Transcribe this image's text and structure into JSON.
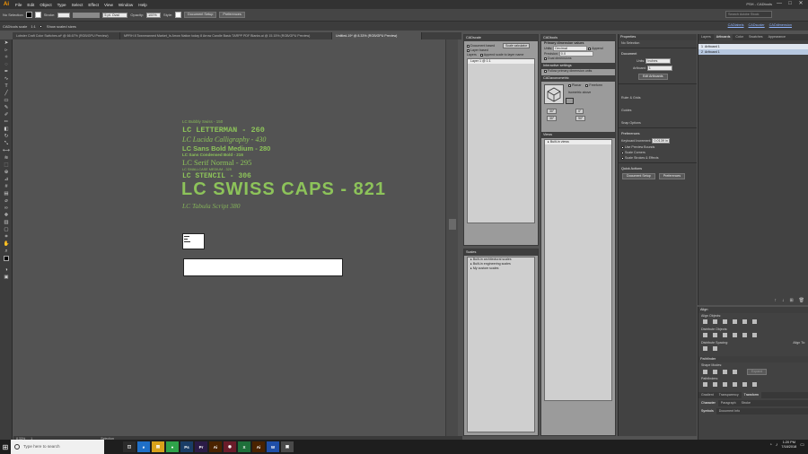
{
  "menubar": {
    "logo": "Ai",
    "items": [
      "File",
      "Edit",
      "Object",
      "Type",
      "Select",
      "Effect",
      "View",
      "Window",
      "Help"
    ],
    "workspace_label": "PSH - CADtools",
    "minimize": "—",
    "maximize": "□",
    "close": "✕"
  },
  "controlbar": {
    "selection": "No Selection",
    "stroke_label": "Stroke:",
    "stroke_value": "",
    "basic_label": "5 pt. Oval",
    "opacity_label": "Opacity:",
    "opacity_value": "100%",
    "style_label": "Style:",
    "doc_setup": "Document Setup",
    "preferences": "Preferences",
    "search_placeholder": "Search Adobe Stock"
  },
  "pluginrow": {
    "left_label": "CADtools scale",
    "scale_value": "1:1",
    "show_scaled": "Show scaled sizes",
    "links": [
      "CADlabels",
      "CADscaler",
      "CADdimension"
    ]
  },
  "tabs": [
    "Lobster Craft Color Switches.ai* @ 66.67% (RGB/GPU Preview)",
    "MPRH 8 Townmanned Market_Is Arrow Nation today 8 Arrow Candle Basic TARPP PDF Blanks.ai @ 15.15% (RGB/GPU Preview)",
    "Untitled-19* @ 8.33% (RGB/GPU Preview)"
  ],
  "canvas": {
    "font_samples": [
      "LC Bubbly Swiss - 150",
      "LC LETTERMAN - 260",
      "LC Lucida Calligraphy - 430",
      "LC Sans Bold Medium - 280",
      "LC Sans Condensed Bold - 216",
      "LC Serif Normal - 295",
      "LC SMALLCASE MEDIUM - 325",
      "LC STENCIL - 306",
      "LC SWISS CAPS - 821",
      "LC Tabula Script 380"
    ],
    "accent_color": "#8dc35a"
  },
  "statusbar": {
    "zoom": "8.33%",
    "artboard": "1",
    "tool": "Selection"
  },
  "cadscale": {
    "title": "CADscale",
    "doc_based": "Document based",
    "scale_btn": "Scale calculator",
    "layer_based": "Layer based",
    "layers_label": "Layers",
    "append": "Append scale to layer name",
    "layer_items": [
      "Layer 1 @ 1:1"
    ],
    "scales_title": "Scales",
    "scale_items": [
      "Built-in architectural scales",
      "Built-in engineering scales",
      "My custom scales"
    ]
  },
  "cadtools": {
    "title": "CADtools",
    "primary_label": "Primary dimension values",
    "units_label": "Units:",
    "units_value": "Decimal",
    "precision_label": "Precision:",
    "precision_value": "0.0",
    "append_units": "Append",
    "dual_dims": "Dual dimensions",
    "interactive_title": "Interactive settings",
    "follow_primary": "Follow primary dimension units",
    "axonometric_title": "CADaxonometric",
    "proj_options": [
      "Planar",
      "Freeform"
    ],
    "isometric_above": "Isometric above",
    "angle1": "30°",
    "angle2": "30°",
    "angle3": "0°",
    "angle4": "90°",
    "views_title": "Views",
    "views_items": [
      "Built-in views"
    ]
  },
  "properties": {
    "title": "Properties",
    "no_selection": "No Selection",
    "document_label": "Document",
    "units_label": "Units:",
    "units_value": "Inches",
    "artboard_label": "Artboard:",
    "artboard_value": "1",
    "edit_artboards": "Edit Artboards",
    "ruler_grids": "Ruler & Grids",
    "guides": "Guides",
    "snap_options": "Snap Options",
    "preferences_label": "Preferences",
    "keyboard_increment": "Keyboard Increment:",
    "keyboard_value": "0.0139 in",
    "use_preview_bounds": "Use Preview Bounds",
    "scale_corners": "Scale Corners",
    "scale_strokes": "Scale Strokes & Effects",
    "quick_actions": "Quick Actions",
    "doc_setup": "Document Setup",
    "preferences_btn": "Preferences"
  },
  "layers": {
    "tabs": [
      "Layers",
      "Artboards",
      "Color",
      "Swatches",
      "Appearance"
    ],
    "rows": [
      {
        "num": "1",
        "name": "Artboard 1"
      },
      {
        "num": "2",
        "name": "Artboard 1"
      }
    ]
  },
  "align": {
    "title": "Align",
    "align_objects": "Align Objects:",
    "distribute_objects": "Distribute Objects:",
    "distribute_spacing": "Distribute Spacing:",
    "align_to": "Align To:",
    "pathfinder_title": "Pathfinder",
    "shape_modes": "Shape Modes:",
    "expand": "Expand",
    "pathfinders": "Pathfinders:",
    "bottom_tabs": [
      "Gradient",
      "Transparency",
      "Transform"
    ],
    "char_tabs": [
      "Character",
      "Paragraph",
      "Stroke"
    ],
    "sym_tabs": [
      "Symbols",
      "Document Info"
    ]
  },
  "taskbar": {
    "search_placeholder": "Type here to search",
    "apps": [
      {
        "label": "◫",
        "color": "#2b2b2b"
      },
      {
        "label": "e",
        "color": "#1f6fc7"
      },
      {
        "label": "▤",
        "color": "#d9a21a"
      },
      {
        "label": "●",
        "color": "#2fa24a"
      },
      {
        "label": "Ps",
        "color": "#1a3d66"
      },
      {
        "label": "Pr",
        "color": "#2b1b47"
      },
      {
        "label": "Ai",
        "color": "#4a2300"
      },
      {
        "label": "◉",
        "color": "#6a1c2a"
      },
      {
        "label": "X",
        "color": "#1e6f3a"
      },
      {
        "label": "Ai",
        "color": "#4a2300"
      },
      {
        "label": "W",
        "color": "#1f4fa8"
      },
      {
        "label": "▣",
        "color": "#4a4a4a"
      }
    ],
    "time": "1:20 PM",
    "date": "7/18/2018"
  }
}
